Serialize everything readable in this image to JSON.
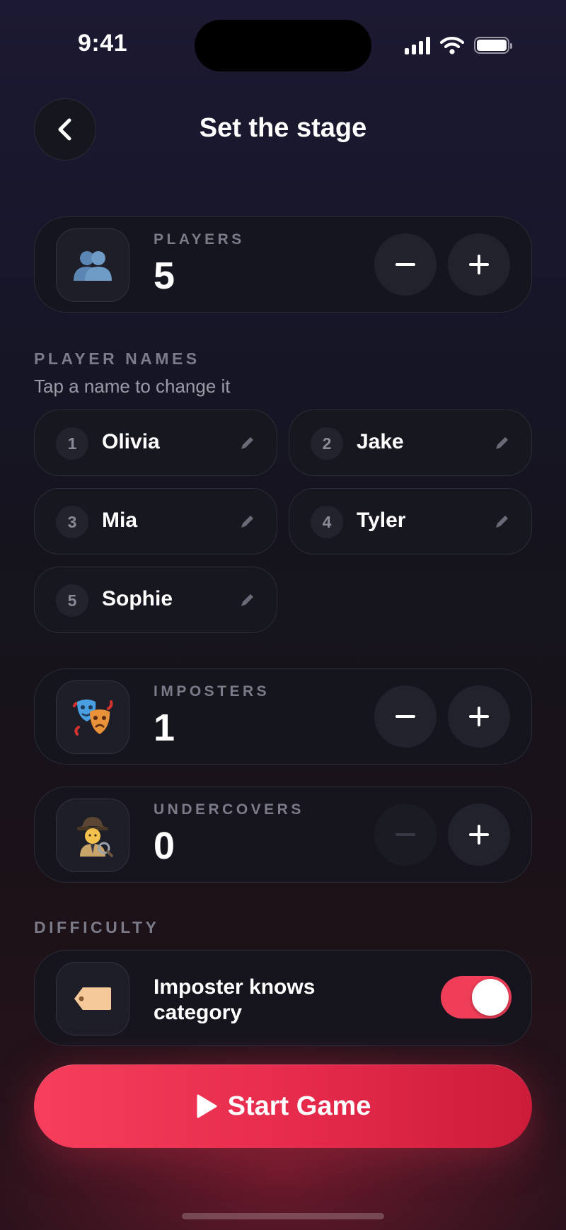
{
  "status_bar": {
    "time": "9:41"
  },
  "header": {
    "title": "Set the stage"
  },
  "players": {
    "label": "PLAYERS",
    "value": "5"
  },
  "player_names": {
    "label": "PLAYER NAMES",
    "hint": "Tap a name to change it",
    "items": [
      {
        "num": "1",
        "name": "Olivia"
      },
      {
        "num": "2",
        "name": "Jake"
      },
      {
        "num": "3",
        "name": "Mia"
      },
      {
        "num": "4",
        "name": "Tyler"
      },
      {
        "num": "5",
        "name": "Sophie"
      }
    ]
  },
  "imposters": {
    "label": "IMPOSTERS",
    "value": "1"
  },
  "undercovers": {
    "label": "UNDERCOVERS",
    "value": "0",
    "minus_disabled": true
  },
  "difficulty": {
    "label": "DIFFICULTY",
    "option_text": "Imposter knows category",
    "enabled": true
  },
  "start": {
    "label": "Start Game"
  },
  "colors": {
    "accent": "#f03e58",
    "button_start": "#f73e5c",
    "button_end": "#cc1c3a",
    "card_bg": "#16161e",
    "label_gray": "#7b7b89"
  },
  "icons": {
    "players": "busts-in-silhouette-icon",
    "imposters": "performing-arts-masks-icon",
    "undercovers": "detective-icon",
    "difficulty": "label-tag-icon"
  }
}
